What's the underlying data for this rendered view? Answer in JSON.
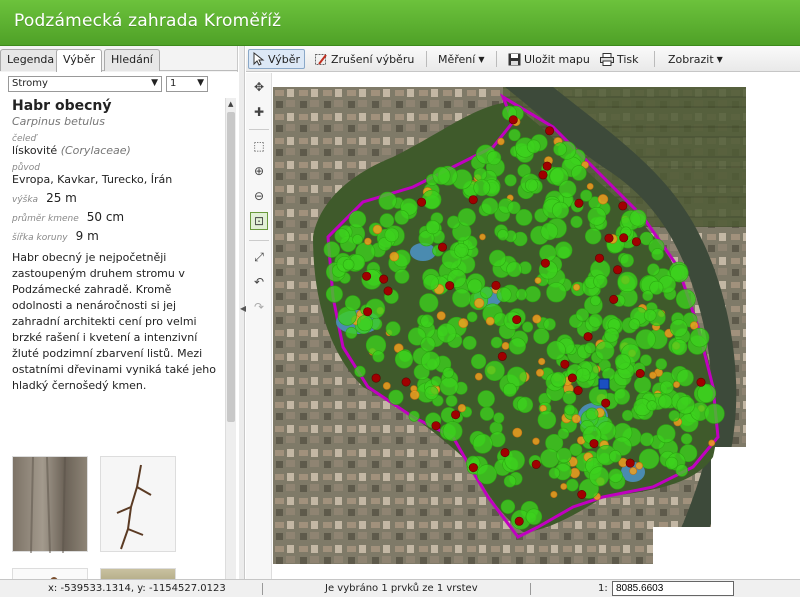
{
  "app": {
    "title": "Podzámecká zahrada Kroměříž"
  },
  "tabs": [
    {
      "label": "Legenda"
    },
    {
      "label": "Výběr",
      "active": true
    },
    {
      "label": "Hledání"
    }
  ],
  "selectors": {
    "layer": "Stromy",
    "item": "1"
  },
  "detail": {
    "name": "Habr obecný",
    "latin": "Carpinus betulus",
    "family_label": "čeleď",
    "family_value": "lískovité",
    "family_latin": "(Corylaceae)",
    "origin_label": "původ",
    "origin_value": "Evropa, Kavkar, Turecko, Írán",
    "height_label": "výška",
    "height_value": "25 m",
    "trunk_label": "průměr kmene",
    "trunk_value": "50 cm",
    "crown_label": "šířka koruny",
    "crown_value": "9 m",
    "description": "Habr obecný je nejpočetněji zastoupeným druhem stromu v Podzámecké zahradě. Kromě odolnosti a nenáročnosti si jej zahradní architekti cení pro velmi brzké rašení i kvetení a intenzivní žluté podzimní zbarvení listů. Mezi ostatními dřevinami vyniká také jeho hladký černošedý kmen."
  },
  "toolbar": {
    "select_label": "Výběr",
    "clear_label": "Zrušení výběru",
    "measure_label": "Měření",
    "save_label": "Uložit mapu",
    "print_label": "Tisk",
    "view_label": "Zobrazit"
  },
  "maptools": [
    {
      "icon": "pan-icon"
    },
    {
      "icon": "add-point-icon"
    },
    {
      "icon": "zoom-box-icon"
    },
    {
      "icon": "zoom-in-icon"
    },
    {
      "icon": "zoom-out-icon"
    },
    {
      "icon": "zoom-extent-icon"
    },
    {
      "icon": "full-extent-icon"
    },
    {
      "icon": "zoom-previous-icon"
    },
    {
      "icon": "zoom-next-icon"
    }
  ],
  "status": {
    "coords": "x: -539533.1314, y: -1154527.0123",
    "selection": "Je vybráno 1 prvků ze 1 vrstev",
    "scale_label": "1:",
    "scale_value": "8085.6603"
  },
  "colors": {
    "header": "#5bb12f",
    "tree_default": "#3cd21e",
    "tree_orange": "#f0a020",
    "tree_red": "#a00000",
    "selected": "#1b4fc0",
    "park_border": "#c000c0"
  }
}
